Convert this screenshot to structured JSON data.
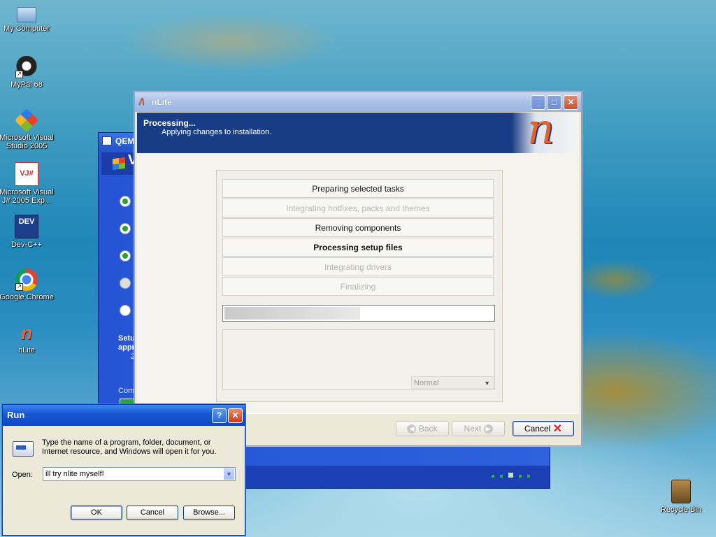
{
  "desktop": {
    "icons": [
      {
        "label": "My Computer",
        "icon": "my-computer-icon"
      },
      {
        "label": "MyPal 68",
        "icon": "mypal-icon"
      },
      {
        "label": "Microsoft Visual Studio 2005",
        "icon": "visual-studio-icon"
      },
      {
        "label": "Microsoft Visual J# 2005 Exp...",
        "icon": "visual-jsharp-icon",
        "glyph": "VJ#"
      },
      {
        "label": "Dev-C++",
        "icon": "devcpp-icon",
        "glyph": "DEV"
      },
      {
        "label": "Google Chrome",
        "icon": "chrome-icon"
      },
      {
        "label": "nLite",
        "icon": "nlite-icon",
        "glyph": "n"
      },
      {
        "label": "Recycle Bin",
        "icon": "recycle-bin-icon"
      }
    ]
  },
  "qemu": {
    "title": "QEMU",
    "side_text_1": "Setu",
    "side_text_2": "appr",
    "side_text_3": "2",
    "comp_text": "Comp"
  },
  "nlite": {
    "title": "nLite",
    "header_title": "Processing...",
    "header_subtitle": "Applying changes to installation.",
    "logo_glyph": "n",
    "tasks": [
      {
        "label": "Preparing selected tasks",
        "state": "done"
      },
      {
        "label": "Integrating hotfixes, packs and themes",
        "state": "disabled"
      },
      {
        "label": "Removing components",
        "state": "done"
      },
      {
        "label": "Processing setup files",
        "state": "current"
      },
      {
        "label": "Integrating drivers",
        "state": "disabled"
      },
      {
        "label": "Finalizing",
        "state": "disabled"
      }
    ],
    "progress": 0.5,
    "priority": "Normal",
    "back_label": "Back",
    "next_label": "Next",
    "cancel_label": "Cancel"
  },
  "run": {
    "title": "Run",
    "description": "Type the name of a program, folder, document, or Internet resource, and Windows will open it for you.",
    "open_label": "Open:",
    "open_value": "ill try nlite myself!",
    "ok_label": "OK",
    "cancel_label": "Cancel",
    "browse_label": "Browse..."
  },
  "colors": {
    "xp_blue": "#0e46c4",
    "nlite_header": "#193d84",
    "dialog_bg": "#ece9d8"
  }
}
